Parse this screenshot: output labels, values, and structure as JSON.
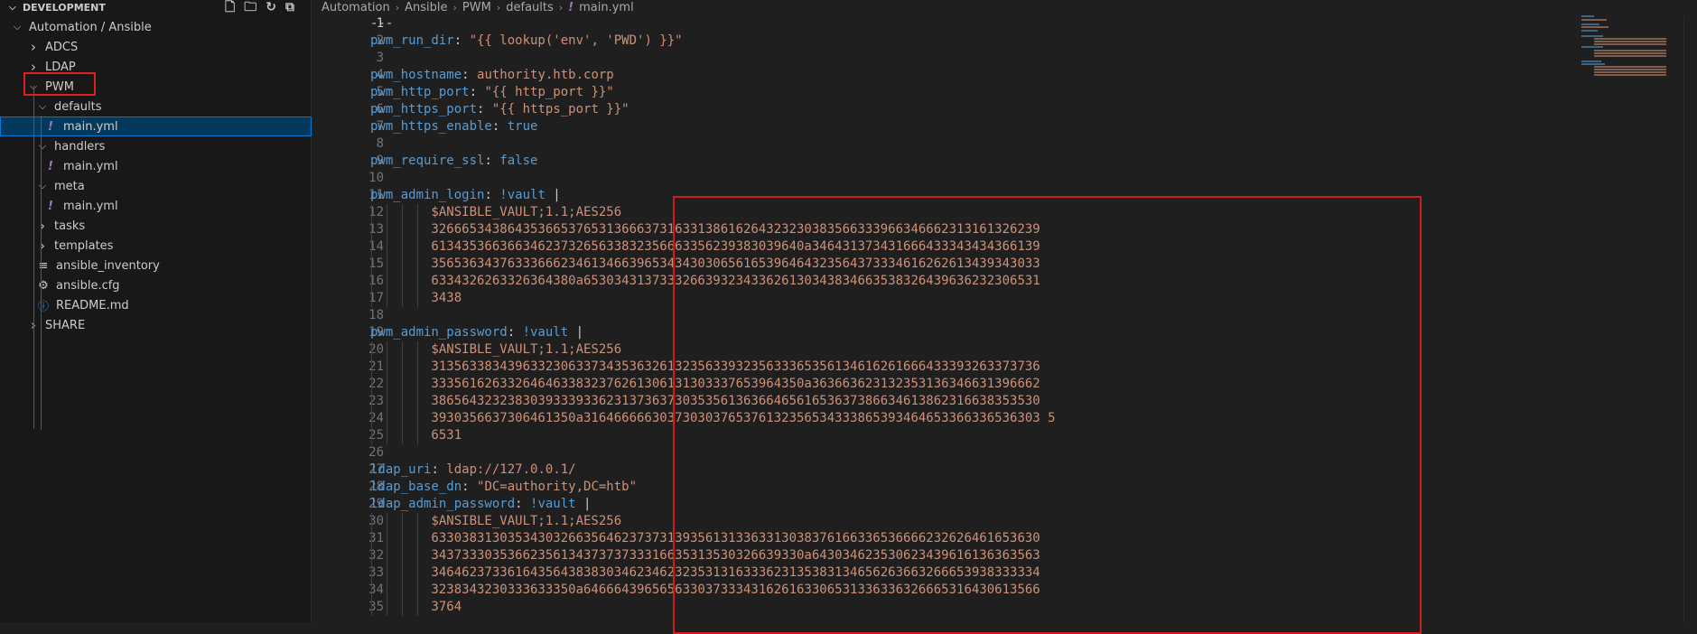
{
  "sidebar": {
    "section_title": "DEVELOPMENT",
    "actions": [
      {
        "name": "new-file-icon",
        "glyph": "🗋"
      },
      {
        "name": "new-folder-icon",
        "glyph": "🗀"
      },
      {
        "name": "refresh-icon",
        "glyph": "↻"
      },
      {
        "name": "collapse-all-icon",
        "glyph": "⧉"
      }
    ],
    "tree": [
      {
        "label": "Automation / Ansible",
        "type": "folder-open",
        "depth": 0
      },
      {
        "label": "ADCS",
        "type": "folder-closed",
        "depth": 1
      },
      {
        "label": "LDAP",
        "type": "folder-closed",
        "depth": 1
      },
      {
        "label": "PWM",
        "type": "folder-open",
        "depth": 1
      },
      {
        "label": "defaults",
        "type": "folder-open",
        "depth": 2
      },
      {
        "label": "main.yml",
        "type": "yml",
        "depth": 3,
        "selected": true
      },
      {
        "label": "handlers",
        "type": "folder-open",
        "depth": 2
      },
      {
        "label": "main.yml",
        "type": "yml",
        "depth": 3
      },
      {
        "label": "meta",
        "type": "folder-open",
        "depth": 2
      },
      {
        "label": "main.yml",
        "type": "yml",
        "depth": 3
      },
      {
        "label": "tasks",
        "type": "folder-closed",
        "depth": 2
      },
      {
        "label": "templates",
        "type": "folder-closed",
        "depth": 2
      },
      {
        "label": "ansible_inventory",
        "type": "plain",
        "depth": 2
      },
      {
        "label": "ansible.cfg",
        "type": "gear",
        "depth": 2
      },
      {
        "label": "README.md",
        "type": "info",
        "depth": 2
      },
      {
        "label": "SHARE",
        "type": "folder-closed",
        "depth": 1
      }
    ]
  },
  "breadcrumb": [
    "Automation",
    "Ansible",
    "PWM",
    "defaults",
    "main.yml"
  ],
  "editor": {
    "active_line": 1,
    "lines": [
      [
        [
          "p",
          "---"
        ]
      ],
      [
        [
          "k",
          "pwm_run_dir"
        ],
        [
          "p",
          ": "
        ],
        [
          "s",
          "\"{{ lookup('env', 'PWD') }}\""
        ]
      ],
      [],
      [
        [
          "k",
          "pwm_hostname"
        ],
        [
          "p",
          ": "
        ],
        [
          "s",
          "authority.htb.corp"
        ]
      ],
      [
        [
          "k",
          "pwm_http_port"
        ],
        [
          "p",
          ": "
        ],
        [
          "s",
          "\"{{ http_port }}\""
        ]
      ],
      [
        [
          "k",
          "pwm_https_port"
        ],
        [
          "p",
          ": "
        ],
        [
          "s",
          "\"{{ https_port }}\""
        ]
      ],
      [
        [
          "k",
          "pwm_https_enable"
        ],
        [
          "p",
          ": "
        ],
        [
          "b",
          "true"
        ]
      ],
      [],
      [
        [
          "k",
          "pwm_require_ssl"
        ],
        [
          "p",
          ": "
        ],
        [
          "b",
          "false"
        ]
      ],
      [],
      [
        [
          "k",
          "pwm_admin_login"
        ],
        [
          "p",
          ": "
        ],
        [
          "t",
          "!vault"
        ],
        [
          "p",
          " |"
        ]
      ],
      [
        [
          "s",
          "        $ANSIBLE_VAULT;1.1;AES256"
        ]
      ],
      [
        [
          "s",
          "        32666534386435366537653136663731633138616264323230383566333966346662313161326239"
        ]
      ],
      [
        [
          "s",
          "        6134353663663462373265633832356663356239383039640a346431373431666433343434366139"
        ]
      ],
      [
        [
          "s",
          "        35653634376333666234613466396534343030656165396464323564373334616262613439343033"
        ]
      ],
      [
        [
          "s",
          "        6334326263326364380a653034313733326639323433626130343834663538326439636232306531"
        ]
      ],
      [
        [
          "s",
          "        3438"
        ]
      ],
      [],
      [
        [
          "k",
          "pwm_admin_password"
        ],
        [
          "p",
          ": "
        ],
        [
          "t",
          "!vault"
        ],
        [
          "p",
          " |"
        ]
      ],
      [
        [
          "s",
          "        $ANSIBLE_VAULT;1.1;AES256"
        ]
      ],
      [
        [
          "s",
          "        31356338343963323063373435363261323563393235633365356134616261666433393263373736"
        ]
      ],
      [
        [
          "s",
          "        3335616263326464633832376261306131303337653964350a363663623132353136346631396662"
        ]
      ],
      [
        [
          "s",
          "        38656432323830393339336231373637303535613636646561653637386634613862316638353530"
        ]
      ],
      [
        [
          "s",
          "        3930356637306461350a316466666303730303765376132356534333865393464653366336536303 5"
        ]
      ],
      [
        [
          "s",
          "        6531"
        ]
      ],
      [],
      [
        [
          "k",
          "ldap_uri"
        ],
        [
          "p",
          ": "
        ],
        [
          "s",
          "ldap://127.0.0.1/"
        ]
      ],
      [
        [
          "k",
          "ldap_base_dn"
        ],
        [
          "p",
          ": "
        ],
        [
          "s",
          "\"DC=authority,DC=htb\""
        ]
      ],
      [
        [
          "k",
          "ldap_admin_password"
        ],
        [
          "p",
          ": "
        ],
        [
          "t",
          "!vault"
        ],
        [
          "p",
          " |"
        ]
      ],
      [
        [
          "s",
          "        $ANSIBLE_VAULT;1.1;AES256"
        ]
      ],
      [
        [
          "s",
          "        63303831303534303266356462373731393561313363313038376166336536666232626461653630"
        ]
      ],
      [
        [
          "s",
          "        3437333035366235613437373733316635313530326639330a643034623530623439616136363563"
        ]
      ],
      [
        [
          "s",
          "        34646237336164356438383034623462323531316333623135383134656263663266653938333334"
        ]
      ],
      [
        [
          "s",
          "        3238343230333633350a646664396565633037333431626163306531336336326665316430613566"
        ]
      ],
      [
        [
          "s",
          "        3764"
        ]
      ]
    ]
  }
}
